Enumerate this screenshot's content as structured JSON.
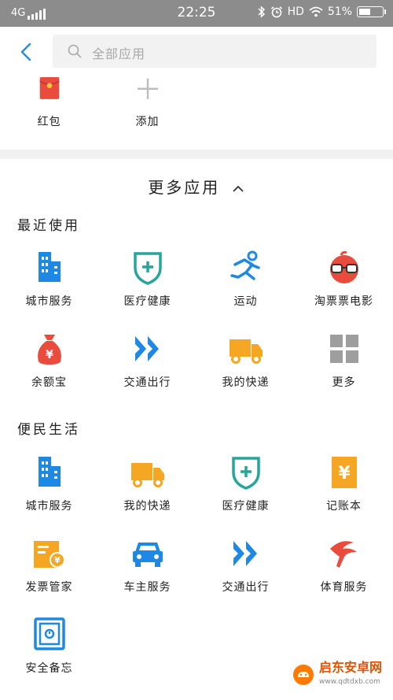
{
  "status": {
    "network": "4G",
    "time": "22:25",
    "hd": "HD",
    "battery": "51%"
  },
  "search": {
    "placeholder": "全部应用"
  },
  "top_apps": [
    {
      "label": "红包",
      "icon": "red-envelope-icon"
    },
    {
      "label": "添加",
      "icon": "plus-icon"
    }
  ],
  "more_title": "更多应用",
  "recent": {
    "title": "最近使用",
    "items": [
      {
        "label": "城市服务",
        "icon": "city-building-icon"
      },
      {
        "label": "医疗健康",
        "icon": "medical-shield-icon"
      },
      {
        "label": "运动",
        "icon": "running-person-icon"
      },
      {
        "label": "淘票票电影",
        "icon": "glasses-mascot-icon"
      },
      {
        "label": "余额宝",
        "icon": "money-bag-icon"
      },
      {
        "label": "交通出行",
        "icon": "double-arrow-icon"
      },
      {
        "label": "我的快递",
        "icon": "delivery-truck-icon"
      },
      {
        "label": "更多",
        "icon": "grid-icon"
      }
    ]
  },
  "life": {
    "title": "便民生活",
    "items": [
      {
        "label": "城市服务",
        "icon": "city-building-icon"
      },
      {
        "label": "我的快递",
        "icon": "delivery-truck-icon"
      },
      {
        "label": "医疗健康",
        "icon": "medical-shield-icon"
      },
      {
        "label": "记账本",
        "icon": "ledger-icon"
      },
      {
        "label": "发票管家",
        "icon": "invoice-icon"
      },
      {
        "label": "车主服务",
        "icon": "car-icon"
      },
      {
        "label": "交通出行",
        "icon": "double-arrow-icon"
      },
      {
        "label": "体育服务",
        "icon": "sports-icon"
      },
      {
        "label": "安全备忘",
        "icon": "safe-icon"
      }
    ]
  },
  "watermark": {
    "brand": "启东安卓网",
    "url": "www.qdtdxb.com"
  },
  "colors": {
    "blue": "#1e88e5",
    "teal": "#26a69a",
    "orange": "#f5a623",
    "red": "#e94b3c",
    "gray": "#9e9e9e",
    "back": "#2b8fd6"
  }
}
